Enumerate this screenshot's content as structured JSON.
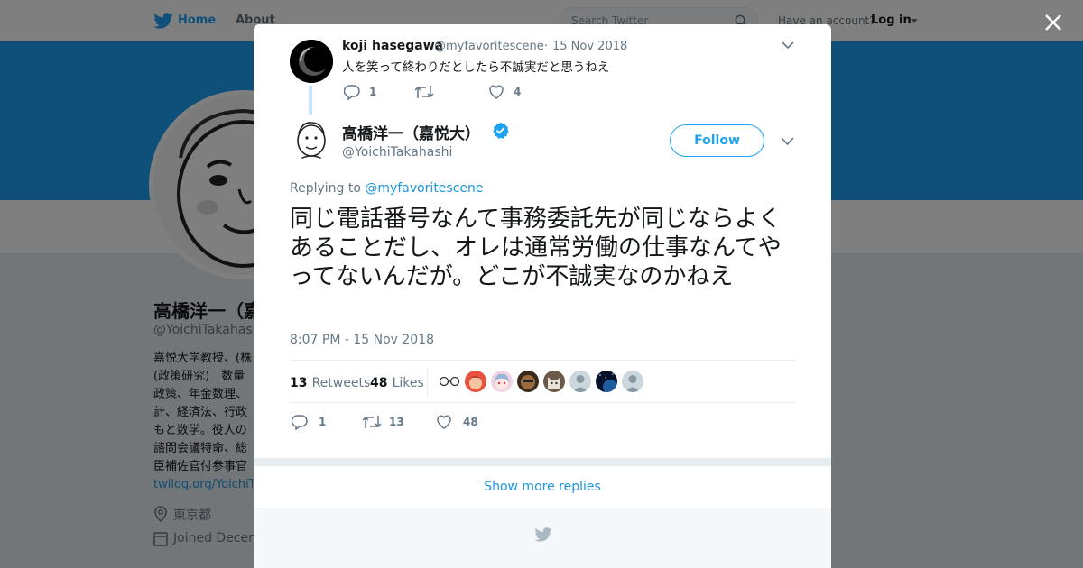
{
  "topbar": {
    "home_label": "Home",
    "about_label": "About",
    "search_placeholder": "Search Twitter",
    "account_prompt": "Have an account?",
    "login_label": "Log in"
  },
  "profile": {
    "name": "高橋洋一（嘉",
    "handle": "@YoichiTakahash",
    "bio_lines": [
      "嘉悦大学教授、(株",
      "(政策研究)　数量",
      "政策、年金数理、",
      "計、経済法、行政",
      "もと数学。役人の",
      "諮問会議特命、総",
      "臣補佐官付参事官"
    ],
    "link": "twilog.org/YoichiTa",
    "location": "東京都",
    "joined": "Joined Decem"
  },
  "parent_tweet": {
    "author_name": "koji hasegawa",
    "author_handle": "@myfavoritescene",
    "separator": "·",
    "date": "15 Nov 2018",
    "text": "人を笑って終わりだとしたら不誠実だと思うねえ",
    "replies": "1",
    "retweets": "",
    "likes": "4"
  },
  "main_tweet": {
    "author_name": "高橋洋一（嘉悦大）",
    "author_handle": "@YoichiTakahashi",
    "follow_label": "Follow",
    "replying_prefix": "Replying to",
    "replying_to": "@myfavoritescene",
    "text": "同じ電話番号なんて事務委託先が同じならよくあることだし、オレは通常労働の仕事なんてやってないんだが。どこが不誠実なのかねえ",
    "timestamp": "8:07 PM - 15 Nov 2018",
    "retweets_count": "13",
    "retweets_label": "Retweets",
    "likes_count": "48",
    "likes_label": "Likes",
    "liker_avatars": [
      "glasses",
      "red-hair",
      "anime",
      "brown-face",
      "cat",
      "default",
      "space",
      "default"
    ],
    "reply_count": "1",
    "retweet_action_count": "13",
    "like_action_count": "48"
  },
  "modal": {
    "show_more_label": "Show more replies"
  },
  "colors": {
    "brand_blue": "#1da1f2",
    "link_blue": "#1b95e0",
    "verified": "#1da1f2",
    "muted_text": "#657786",
    "thread_line": "#c4e6fb"
  }
}
